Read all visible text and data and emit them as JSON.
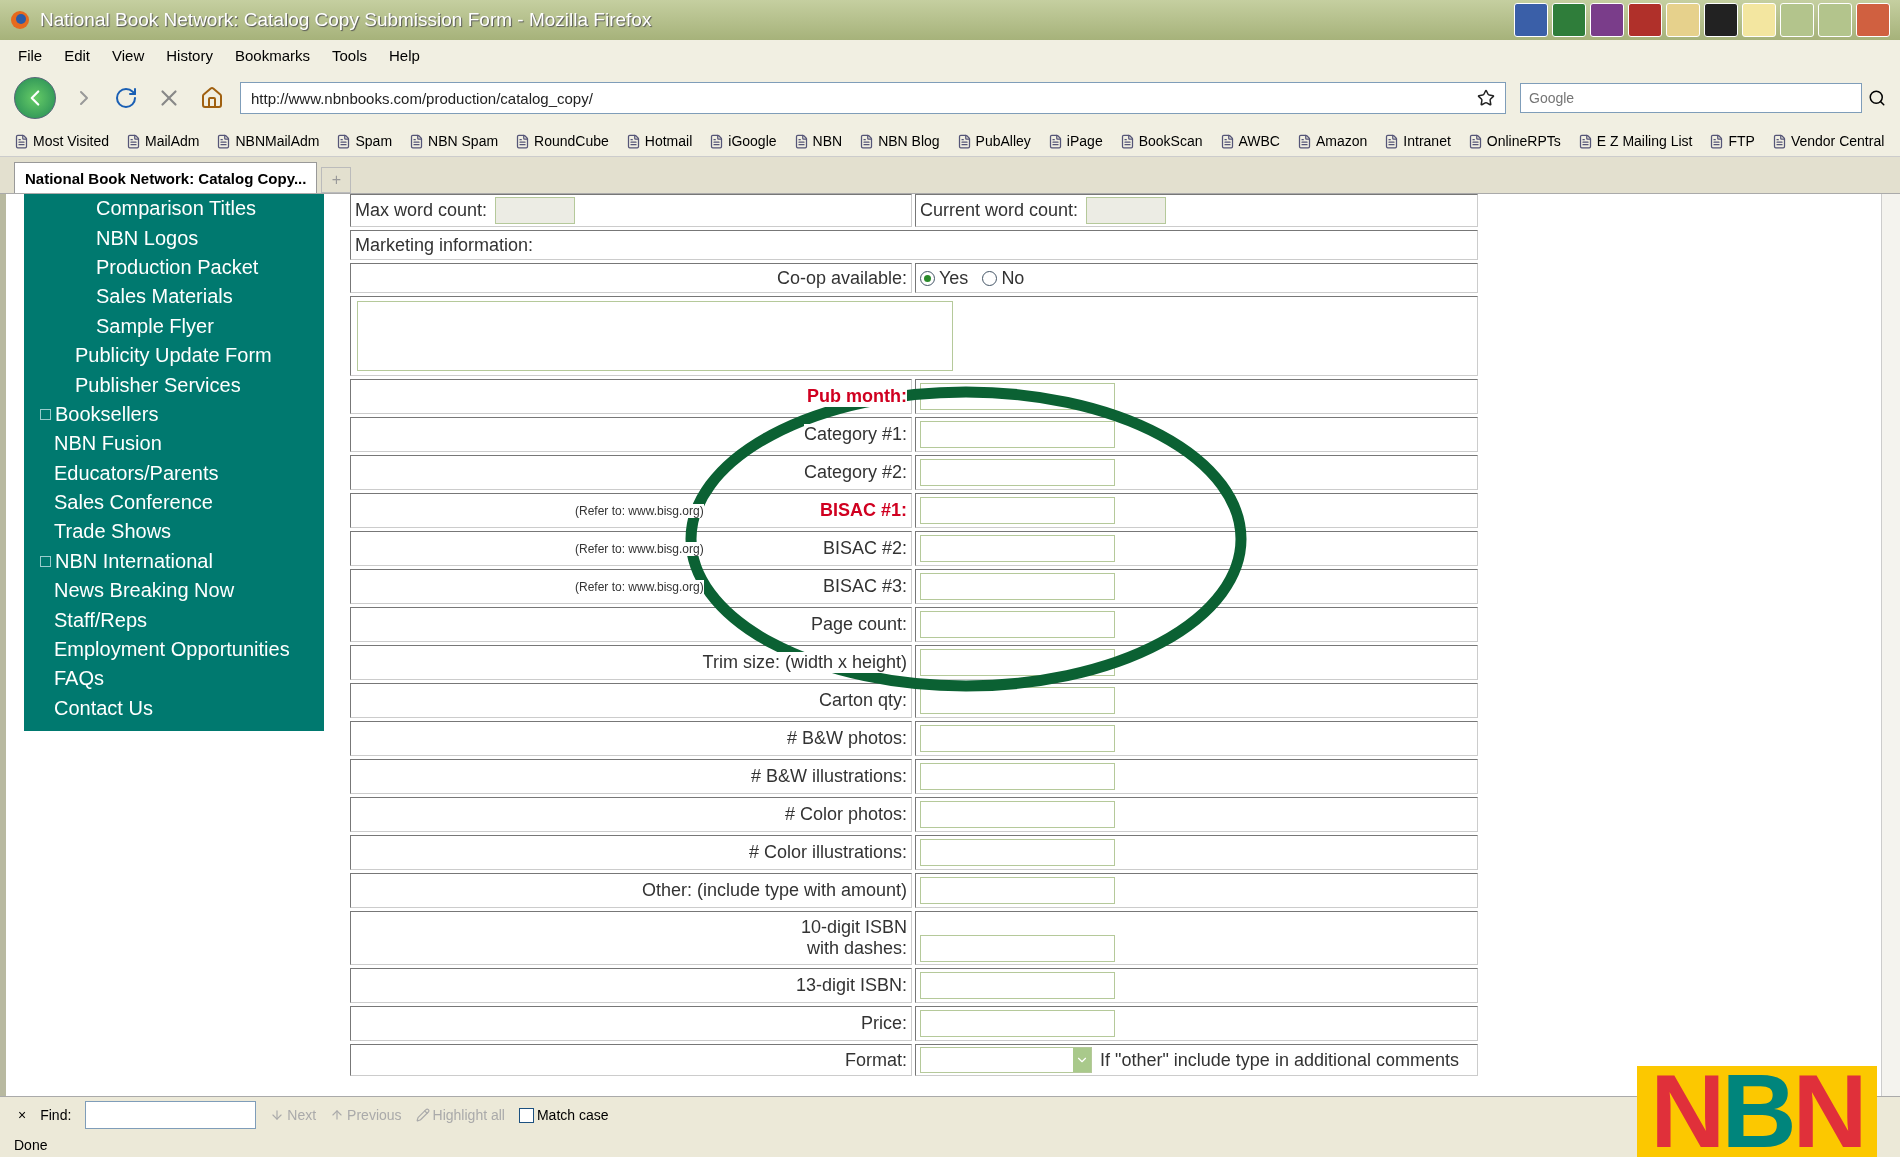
{
  "window": {
    "title": "National Book Network: Catalog Copy Submission Form - Mozilla Firefox"
  },
  "menu": [
    "File",
    "Edit",
    "View",
    "History",
    "Bookmarks",
    "Tools",
    "Help"
  ],
  "address": {
    "url": "http://www.nbnbooks.com/production/catalog_copy/"
  },
  "search": {
    "placeholder": "Google"
  },
  "bookmarks": [
    "Most Visited",
    "MailAdm",
    "NBNMailAdm",
    "Spam",
    "NBN Spam",
    "RoundCube",
    "Hotmail",
    "iGoogle",
    "NBN",
    "NBN Blog",
    "PubAlley",
    "iPage",
    "BookScan",
    "AWBC",
    "Amazon",
    "Intranet",
    "OnlineRPTs",
    "E Z Mailing List",
    "FTP",
    "Vendor Central"
  ],
  "tabs": [
    {
      "label": "National Book Network: Catalog Copy...",
      "selected": true
    }
  ],
  "new_tab": "+",
  "sidebar": {
    "items": [
      {
        "children": [
          {
            "children": [
              {
                "label": "Comparison Titles"
              },
              {
                "label": "NBN Logos"
              },
              {
                "label": "Production Packet"
              },
              {
                "label": "Sales Materials"
              },
              {
                "label": "Sample Flyer"
              }
            ]
          },
          {
            "label": "Publicity Update Form"
          },
          {
            "label": "Publisher Services"
          }
        ]
      },
      {
        "label": "Booksellers",
        "expanded": false
      },
      {
        "label": "NBN Fusion"
      },
      {
        "label": "Educators/Parents"
      },
      {
        "label": "Sales Conference"
      },
      {
        "label": "Trade Shows"
      },
      {
        "label": "NBN International",
        "expanded": false
      },
      {
        "label": "News Breaking Now"
      },
      {
        "label": "Staff/Reps"
      },
      {
        "label": "Employment Opportunities"
      },
      {
        "label": "FAQs"
      },
      {
        "label": "Contact Us"
      }
    ]
  },
  "form": {
    "rows": [
      {
        "kind": "counts",
        "label": "Max word count:",
        "label_2": "Current word count:"
      },
      {
        "kind": "section",
        "label": "Marketing information:"
      },
      {
        "kind": "radio",
        "label": "Co-op available:",
        "options": [
          {
            "label": "Yes",
            "selected": true
          },
          {
            "label": "No",
            "selected": false
          }
        ]
      },
      {
        "kind": "textarea"
      },
      {
        "kind": "field",
        "label": "Pub month:",
        "required": true
      },
      {
        "kind": "field",
        "label": "Category #1:",
        "required": false
      },
      {
        "kind": "field",
        "label": "Category #2:",
        "required": false
      },
      {
        "kind": "field",
        "label": "BISAC #1:",
        "required": true,
        "note": "(Refer to: www.bisg.org)"
      },
      {
        "kind": "field",
        "label": "BISAC #2:",
        "required": false,
        "note": "(Refer to: www.bisg.org)"
      },
      {
        "kind": "field",
        "label": "BISAC #3:",
        "required": false,
        "note": "(Refer to: www.bisg.org)"
      },
      {
        "kind": "field",
        "label": "Page count:",
        "required": false
      },
      {
        "kind": "field",
        "label": "Trim size: (width x height)",
        "required": false
      },
      {
        "kind": "field",
        "label": "Carton qty:",
        "required": false
      },
      {
        "kind": "field",
        "label": "# B&W photos:",
        "required": false
      },
      {
        "kind": "field",
        "label": "# B&W illustrations:",
        "required": false
      },
      {
        "kind": "field",
        "label": "# Color photos:",
        "required": false
      },
      {
        "kind": "field",
        "label": "# Color illustrations:",
        "required": false
      },
      {
        "kind": "field",
        "label": "Other: (include type with amount)",
        "required": false
      },
      {
        "kind": "field",
        "label": "10-digit ISBN\nwith dashes:",
        "required": false
      },
      {
        "kind": "field",
        "label": "13-digit ISBN:",
        "required": false
      },
      {
        "kind": "field",
        "label": "Price:",
        "required": false
      },
      {
        "kind": "select",
        "label": "Format:",
        "hint": "If \"other\" include type in additional comments"
      }
    ]
  },
  "find_bar": {
    "close": "×",
    "label": "Find:",
    "buttons": [
      {
        "label": "Next",
        "disabled": true
      },
      {
        "label": "Previous",
        "disabled": true
      },
      {
        "label": "Highlight all",
        "disabled": true
      }
    ],
    "match_case": {
      "label": "Match case",
      "checked": false
    }
  },
  "status_bar": "Done",
  "logo": {
    "letters": [
      {
        "char": "N",
        "color": "#e0303a"
      },
      {
        "char": "B",
        "color": "#00857c"
      },
      {
        "char": "N",
        "color": "#e0303a"
      }
    ]
  }
}
